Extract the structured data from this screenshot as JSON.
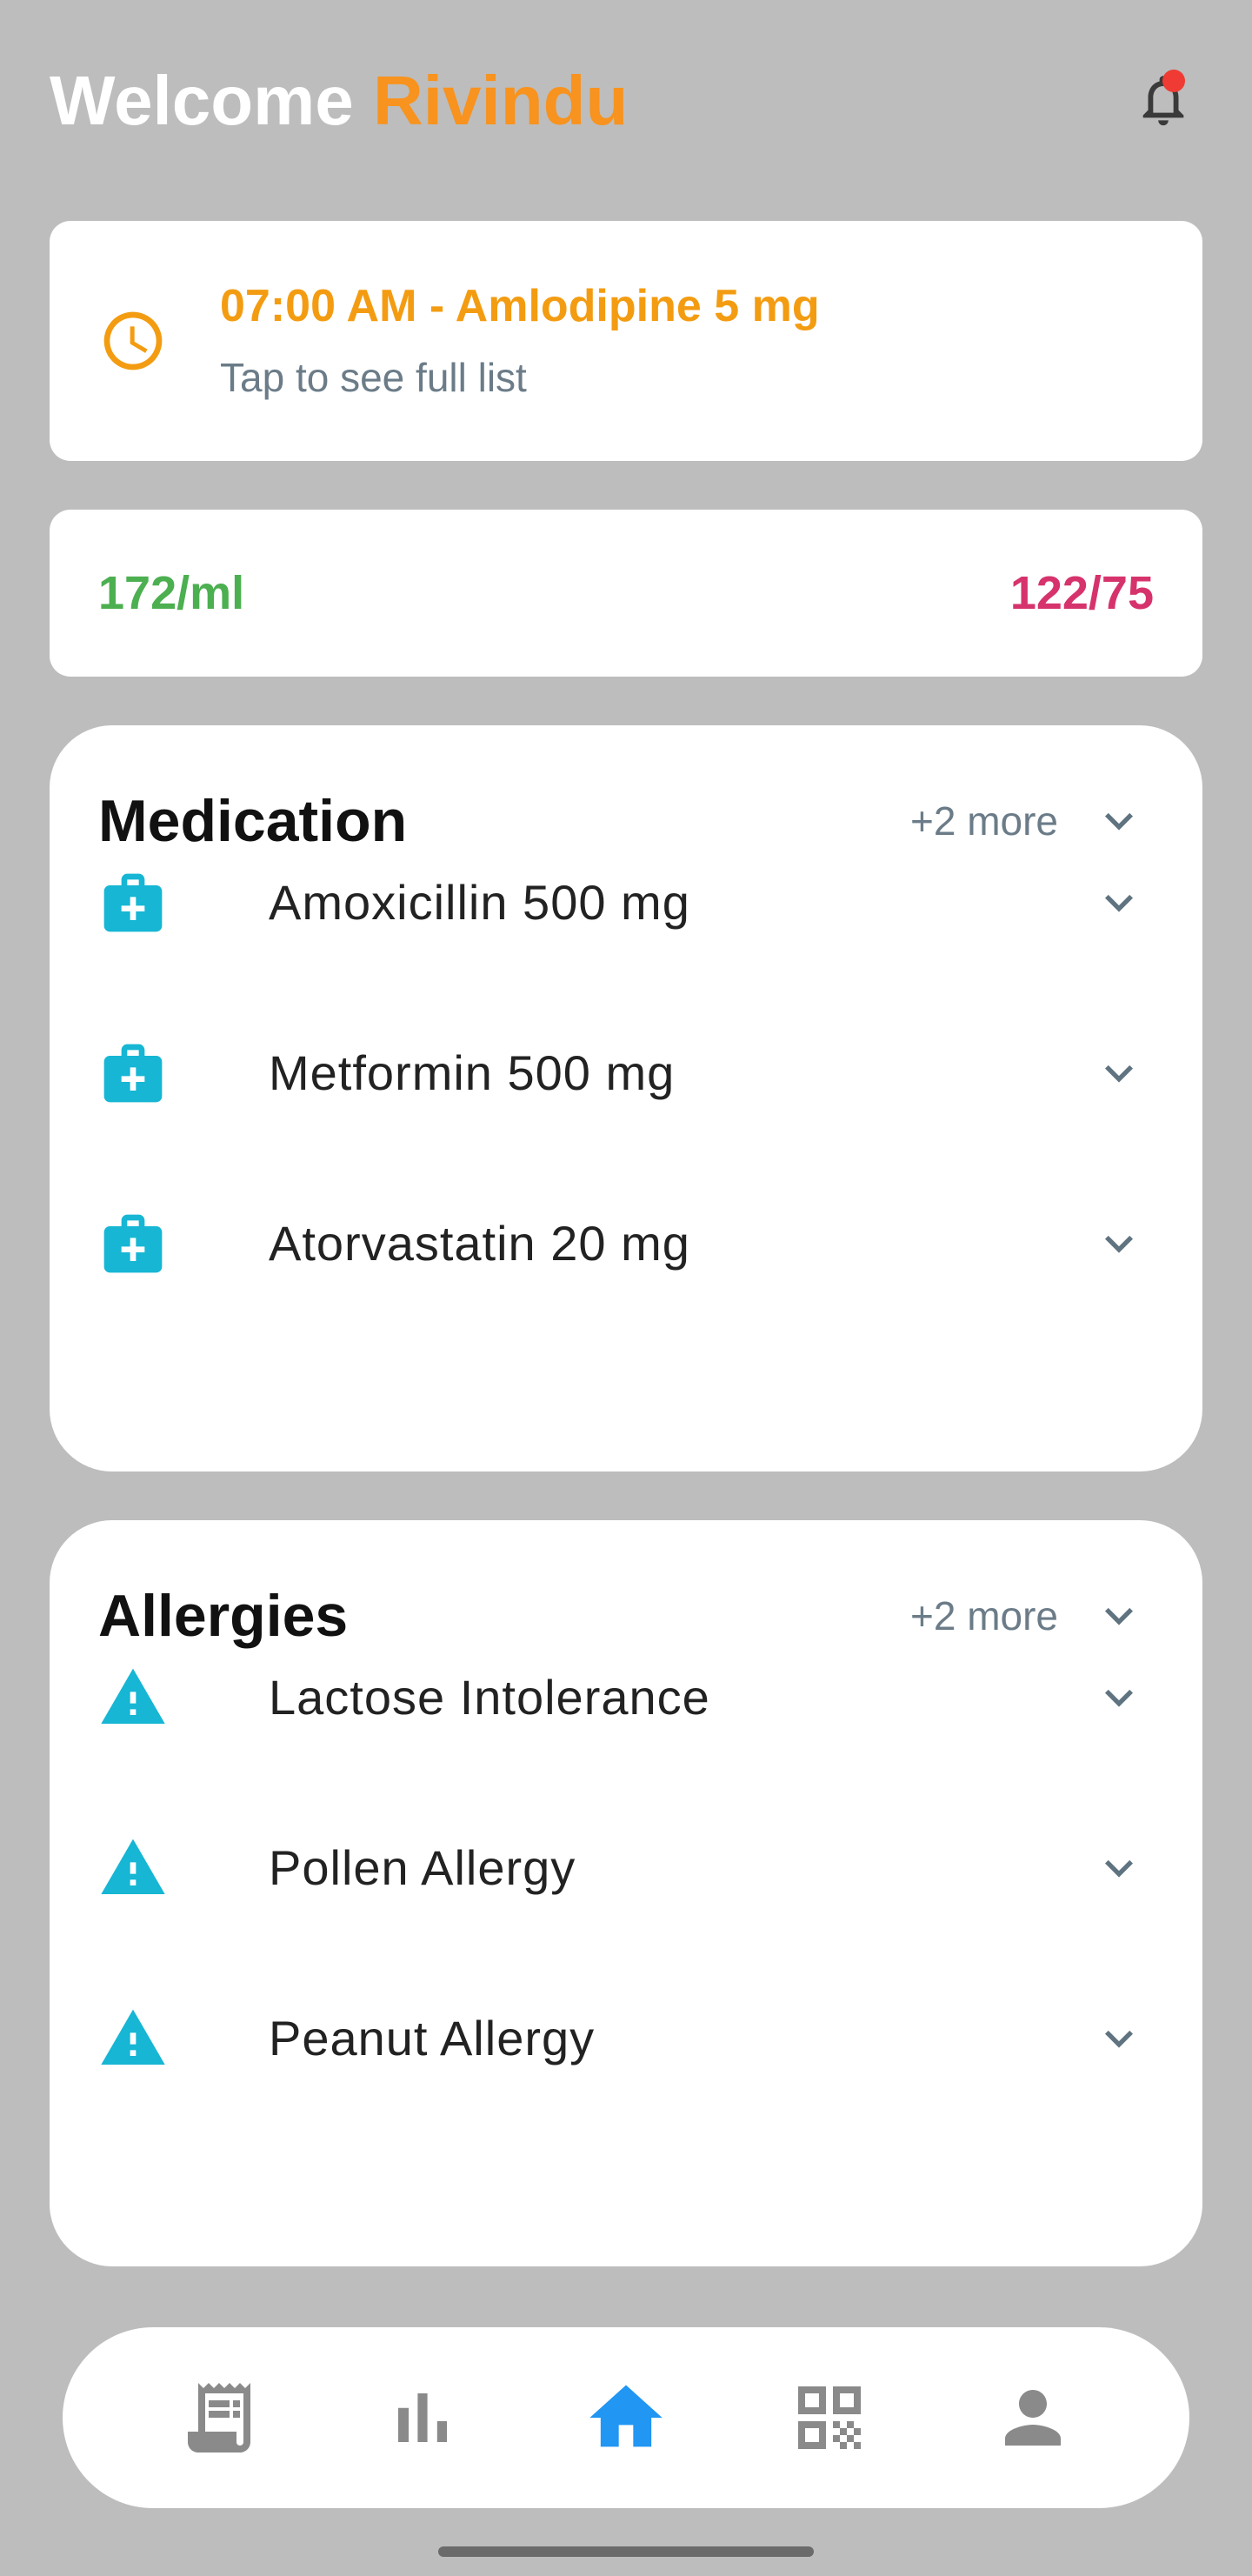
{
  "header": {
    "welcome_text": "Welcome",
    "user_name": "Rivindu",
    "notification_dot_color": "#ef3b33"
  },
  "reminder": {
    "title": "07:00 AM - Amlodipine 5 mg",
    "subtitle": "Tap to see full list",
    "icon": "clock-icon"
  },
  "vitals": {
    "left_value": "172/ml",
    "right_value": "122/75"
  },
  "medication": {
    "title": "Medication",
    "more_label": "+2 more",
    "items": [
      {
        "label": "Amoxicillin 500 mg",
        "icon": "medical-kit-icon"
      },
      {
        "label": "Metformin 500 mg",
        "icon": "medical-kit-icon"
      },
      {
        "label": "Atorvastatin 20 mg",
        "icon": "medical-kit-icon"
      }
    ]
  },
  "allergies": {
    "title": "Allergies",
    "more_label": "+2 more",
    "items": [
      {
        "label": "Lactose Intolerance",
        "icon": "warning-icon"
      },
      {
        "label": "Pollen Allergy",
        "icon": "warning-icon"
      },
      {
        "label": "Peanut Allergy",
        "icon": "warning-icon"
      }
    ]
  },
  "navbar": {
    "items": [
      {
        "name": "receipt-icon",
        "active": false
      },
      {
        "name": "bar-chart-icon",
        "active": false
      },
      {
        "name": "home-icon",
        "active": true
      },
      {
        "name": "qr-code-icon",
        "active": false
      },
      {
        "name": "person-icon",
        "active": false
      }
    ]
  },
  "colors": {
    "background": "#bdbdbd",
    "accent_orange": "#f7931e",
    "reminder_orange": "#f39c12",
    "green": "#4caf50",
    "pink": "#d6336c",
    "icon_teal": "#16b6d4",
    "active_blue": "#2196f3",
    "inactive_gray": "#8a8a8a"
  }
}
